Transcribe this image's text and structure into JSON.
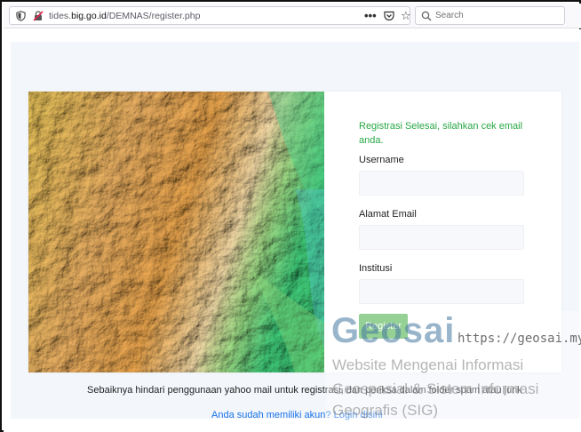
{
  "browser": {
    "url_prefix": "tides.",
    "url_domain": "big.go.id",
    "url_path": "/DEMNAS/register.php",
    "more_glyph": "•••",
    "star_glyph": "☆",
    "search_placeholder": "Search"
  },
  "form": {
    "success_message": "Registrasi Selesai, silahkan cek email anda.",
    "username_label": "Username",
    "username_value": "",
    "email_label": "Alamat Email",
    "email_value": "",
    "institution_label": "Institusi",
    "institution_value": "",
    "register_label": "Register"
  },
  "footer": {
    "note": "Sebaiknya hindari penggunaan yahoo mail untuk registrasi, dan periksa dalam folder spam atau junk",
    "login_question": "Anda sudah memiliki akun? ",
    "login_link": "Login disini"
  },
  "watermark": {
    "title": "Geosai",
    "url": "https://geosai.my.id",
    "line1": "Website Mengenai Informasi",
    "line2": "Geospasial & Sistem Informasi",
    "line3": "Geografis (SIG)"
  },
  "colors": {
    "success": "#28a745",
    "button": "#5cb85c",
    "link": "#1a73e8"
  }
}
